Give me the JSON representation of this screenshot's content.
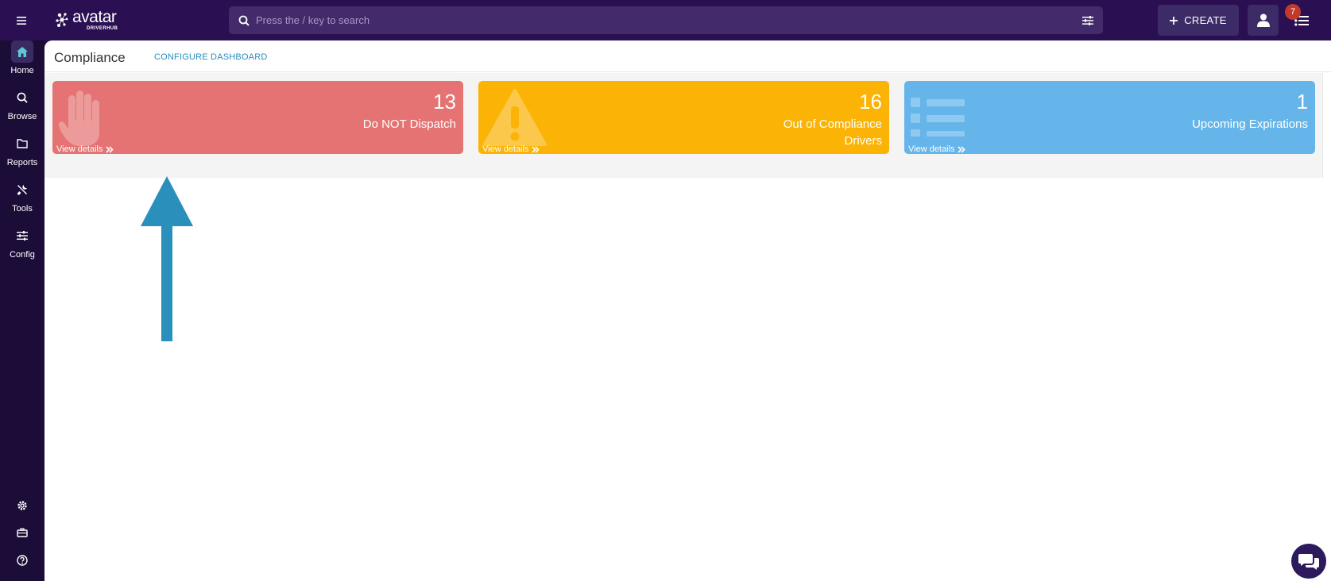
{
  "header": {
    "logo_text": "avatar",
    "logo_sub": "DRIVERHUB",
    "search": {
      "placeholder": "Press the / key to search"
    },
    "create_label": "CREATE",
    "notification_count": "7"
  },
  "sidebar": {
    "items": [
      {
        "label": "Home",
        "icon": "home-icon",
        "active": true
      },
      {
        "label": "Browse",
        "icon": "search-icon"
      },
      {
        "label": "Reports",
        "icon": "folder-icon"
      },
      {
        "label": "Tools",
        "icon": "tools-icon"
      },
      {
        "label": "Config",
        "icon": "sliders-icon"
      }
    ],
    "bottom_icons": [
      "gear-icon",
      "briefcase-icon",
      "help-icon"
    ]
  },
  "page": {
    "title": "Compliance",
    "configure_label": "CONFIGURE DASHBOARD"
  },
  "cards": [
    {
      "count": "13",
      "label": "Do NOT Dispatch",
      "link": "View details",
      "color": "#e57373",
      "icon": "hand-stop-icon"
    },
    {
      "count": "16",
      "label": "Out of Compliance Drivers",
      "link": "View details",
      "color": "#fbb306",
      "icon": "warning-icon"
    },
    {
      "count": "1",
      "label": "Upcoming Expirations",
      "link": "View details",
      "color": "#65b5ea",
      "icon": "list-icon"
    }
  ],
  "colors": {
    "topbar": "#2a0f52",
    "sidebar": "#1c0c38",
    "accent_link": "#2a8fc1",
    "annotation_arrow": "#2a8fbb"
  }
}
